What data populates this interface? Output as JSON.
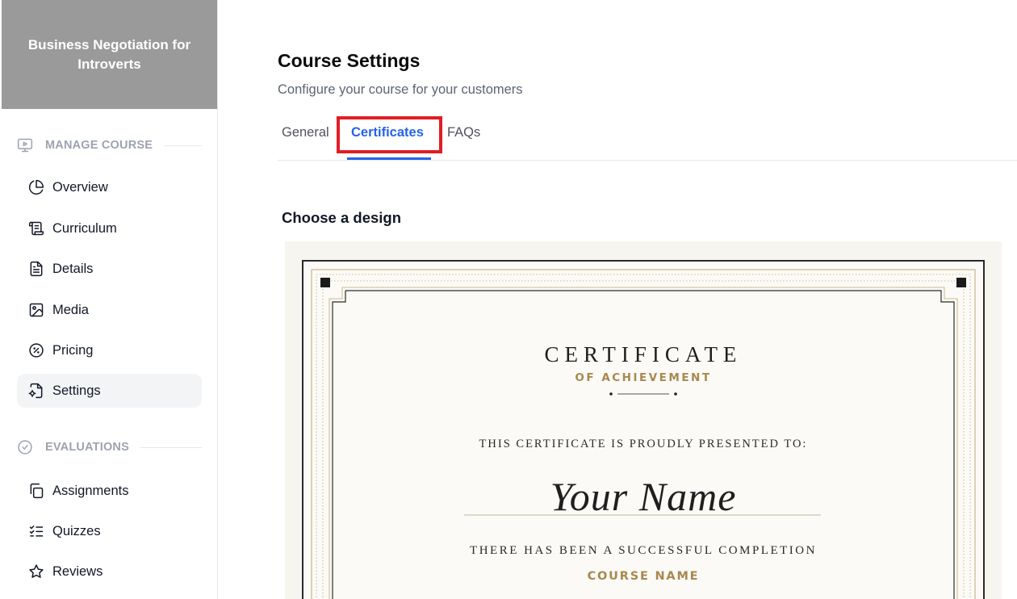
{
  "sidebar": {
    "course_title": "Business Negotiation for Introverts",
    "sections": [
      {
        "label": "MANAGE COURSE",
        "icon": "presentation-icon",
        "items": [
          {
            "label": "Overview",
            "icon": "pie-chart-icon"
          },
          {
            "label": "Curriculum",
            "icon": "scroll-icon"
          },
          {
            "label": "Details",
            "icon": "file-text-icon"
          },
          {
            "label": "Media",
            "icon": "image-icon"
          },
          {
            "label": "Pricing",
            "icon": "badge-percent-icon"
          },
          {
            "label": "Settings",
            "icon": "file-cog-icon",
            "active": true
          }
        ]
      },
      {
        "label": "EVALUATIONS",
        "icon": "check-circle-icon",
        "items": [
          {
            "label": "Assignments",
            "icon": "copy-icon"
          },
          {
            "label": "Quizzes",
            "icon": "list-checks-icon"
          },
          {
            "label": "Reviews",
            "icon": "star-icon"
          }
        ]
      }
    ]
  },
  "main": {
    "title": "Course Settings",
    "subtitle": "Configure your course for your customers",
    "tabs": [
      {
        "label": "General"
      },
      {
        "label": "Certificates",
        "active": true
      },
      {
        "label": "FAQs"
      }
    ],
    "design_label": "Choose a design",
    "certificate": {
      "title": "CERTIFICATE",
      "subtitle": "OF ACHIEVEMENT",
      "presented": "THIS CERTIFICATE IS PROUDLY PRESENTED TO:",
      "name": "Your Name",
      "completion": "THERE HAS BEEN A SUCCESSFUL COMPLETION",
      "course": "COURSE NAME"
    }
  },
  "colors": {
    "accent": "#2563eb",
    "highlight": "#e11d24",
    "gold": "#a8884e",
    "header_bg": "#9a9a9a"
  }
}
